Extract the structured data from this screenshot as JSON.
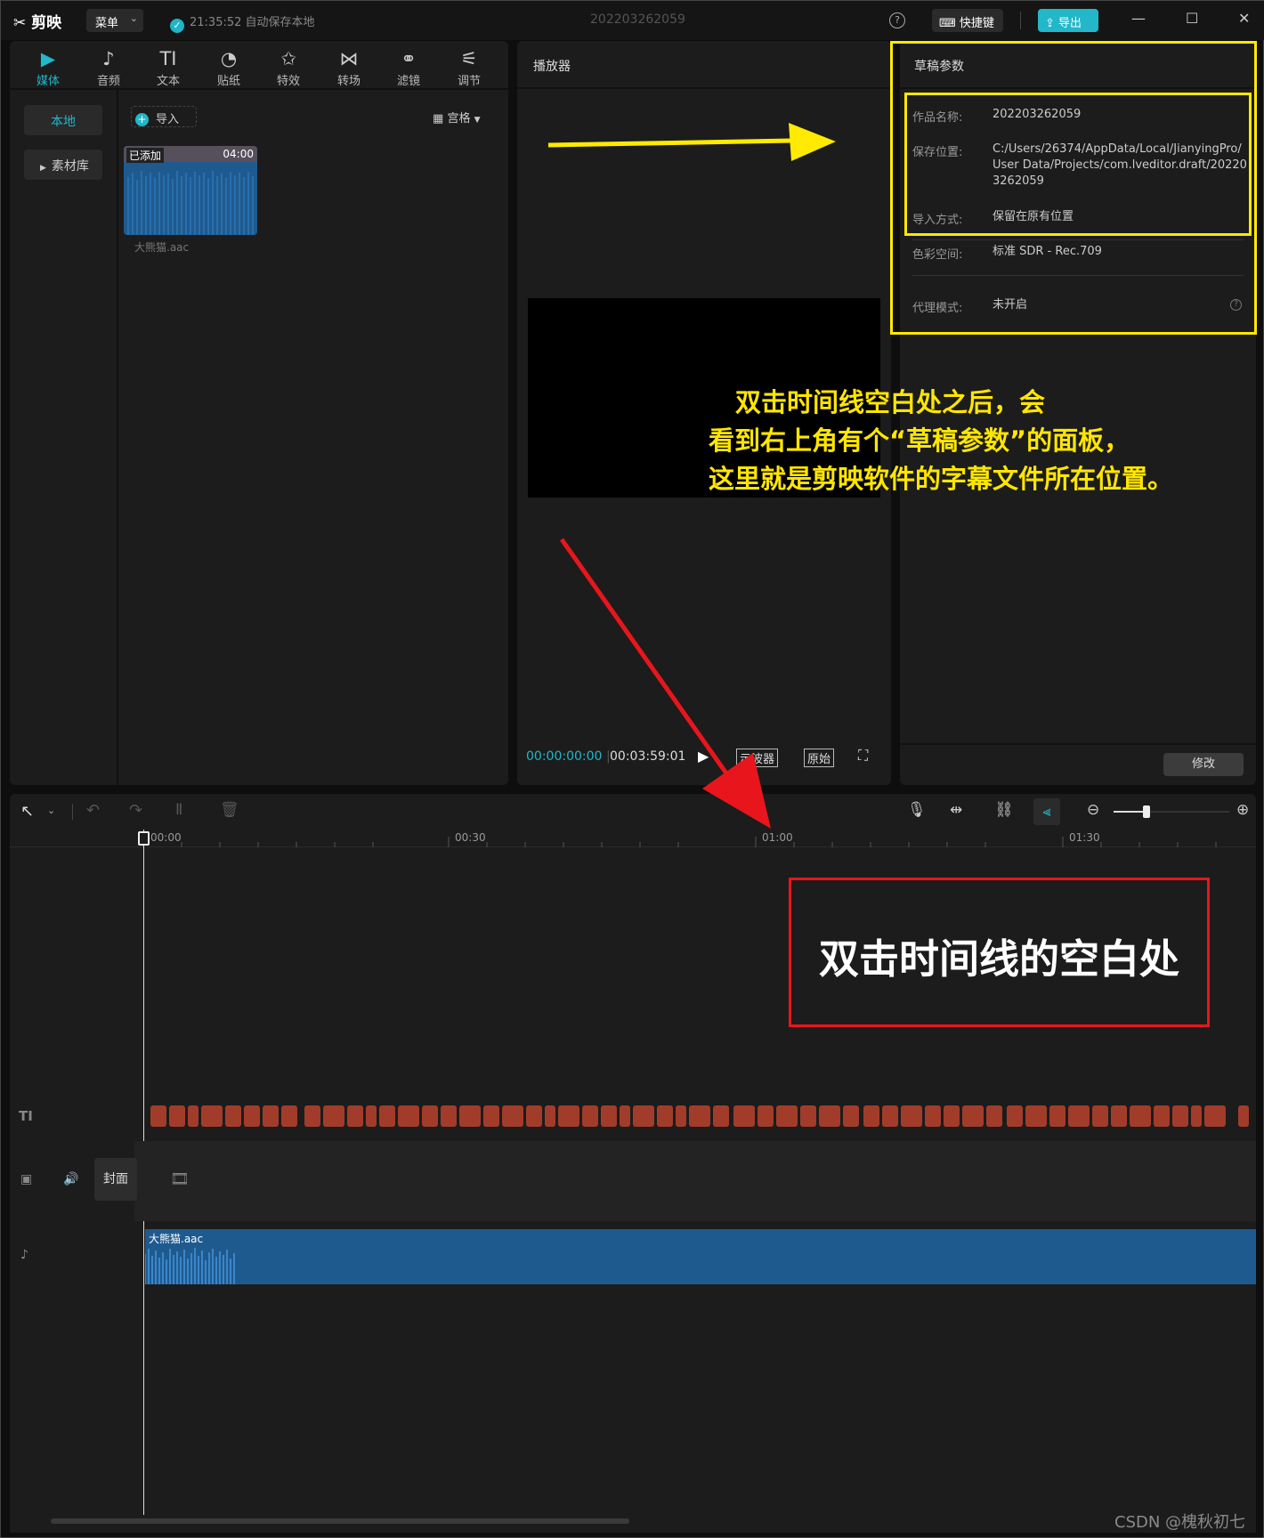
{
  "app": {
    "logo": "剪映",
    "menu": "菜单",
    "autosave_time": "21:35:52",
    "autosave_text": "自动保存本地",
    "project_title": "202203262059",
    "shortcut": "快捷键",
    "export": "导出"
  },
  "toolbar_tabs": [
    {
      "icon": "media-icon",
      "glyph": "▶",
      "label": "媒体"
    },
    {
      "icon": "audio-icon",
      "glyph": "♪",
      "label": "音频"
    },
    {
      "icon": "text-icon",
      "glyph": "TI",
      "label": "文本"
    },
    {
      "icon": "sticker-icon",
      "glyph": "◔",
      "label": "贴纸"
    },
    {
      "icon": "effects-icon",
      "glyph": "✩",
      "label": "特效"
    },
    {
      "icon": "transition-icon",
      "glyph": "⋈",
      "label": "转场"
    },
    {
      "icon": "filter-icon",
      "glyph": "⚭",
      "label": "滤镜"
    },
    {
      "icon": "adjust-icon",
      "glyph": "⚟",
      "label": "调节"
    }
  ],
  "media": {
    "sidebar": [
      "本地",
      "素材库"
    ],
    "import": "导入",
    "view": "宫格",
    "clip_badge": "已添加",
    "clip_duration": "04:00",
    "clip_name": "大熊猫.aac"
  },
  "player": {
    "title": "播放器",
    "current_time": "00:00:00:00",
    "total_time": "00:03:59:01",
    "scope": "示波器",
    "ratio": "原始"
  },
  "draft": {
    "title": "草稿参数",
    "rows": [
      {
        "label": "作品名称:",
        "value": "202203262059"
      },
      {
        "label": "保存位置:",
        "value": "C:/Users/26374/AppData/Local/JianyingPro/User Data/Projects/com.lveditor.draft/202203262059"
      },
      {
        "label": "导入方式:",
        "value": "保留在原有位置"
      },
      {
        "label": "色彩空间:",
        "value": "标准 SDR - Rec.709"
      },
      {
        "label": "代理模式:",
        "value": "未开启"
      }
    ],
    "modify": "修改"
  },
  "annotation_top": [
    "双击时间线空白处之后，会",
    "看到右上角有个“草稿参数”的面板，",
    "这里就是剪映软件的字幕文件所在位置。"
  ],
  "annotation_box": "双击时间线的空白处",
  "timeline": {
    "ruler": [
      "00:00",
      "00:30",
      "01:00",
      "01:30"
    ],
    "cover": "封面",
    "audio_clip": "大熊猫.aac"
  },
  "watermark": "CSDN @槐秋初七",
  "colors": {
    "accent": "#22b7c9",
    "annotation_yellow": "#ffea00",
    "annotation_red": "#e8161c",
    "caption_clip": "#a23c2a",
    "audio_clip": "#1f5a8f"
  }
}
